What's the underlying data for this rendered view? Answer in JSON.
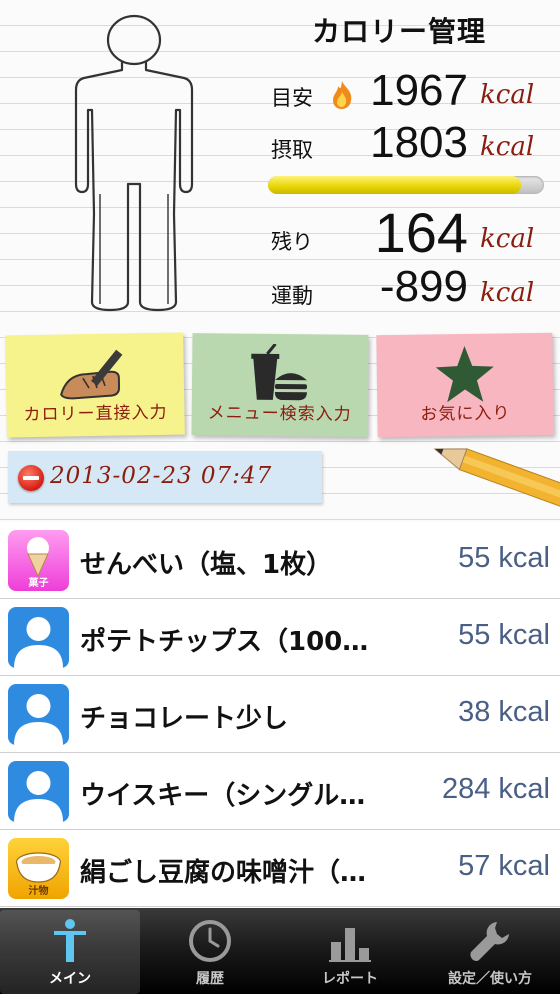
{
  "summary": {
    "title": "カロリー管理",
    "target_label": "目安",
    "target_value": "1967",
    "intake_label": "摂取",
    "intake_value": "1803",
    "remaining_label": "残り",
    "remaining_value": "164",
    "exercise_label": "運動",
    "exercise_value": "-899",
    "unit": "kcal",
    "progress_fraction": 0.917
  },
  "actions": {
    "direct_label": "カロリー直接入力",
    "menu_label": "メニュー検索入力",
    "favorite_label": "お気に入り"
  },
  "entry": {
    "datetime": "2013-02-23 07:47"
  },
  "food_items": [
    {
      "name": "せんべい（塩、1枚）",
      "kcal": "55 kcal",
      "thumb": "ice-cream-icon",
      "thumb_label": "菓子"
    },
    {
      "name": "ポテトチップス（100…",
      "kcal": "55 kcal",
      "thumb": "person-placeholder-icon"
    },
    {
      "name": "チョコレート少し",
      "kcal": "38 kcal",
      "thumb": "person-placeholder-icon"
    },
    {
      "name": "ウイスキー（シングル…",
      "kcal": "284 kcal",
      "thumb": "person-placeholder-icon"
    },
    {
      "name": "絹ごし豆腐の味噌汁（…",
      "kcal": "57 kcal",
      "thumb": "soup-bowl-icon",
      "thumb_label": "汁物"
    }
  ],
  "tabs": [
    {
      "label": "メイン",
      "icon": "person-icon",
      "active": true
    },
    {
      "label": "履歴",
      "icon": "clock-icon"
    },
    {
      "label": "レポート",
      "icon": "bar-chart-icon"
    },
    {
      "label": "設定／使い方",
      "icon": "wrench-icon"
    }
  ],
  "colors": {
    "unit_text": "#8b1d0e",
    "kcal_text": "#4a5f85",
    "progress_fill": "#e6d400",
    "placeholder_blue": "#2f8be0",
    "tab_bar": "#1b1b1b"
  }
}
